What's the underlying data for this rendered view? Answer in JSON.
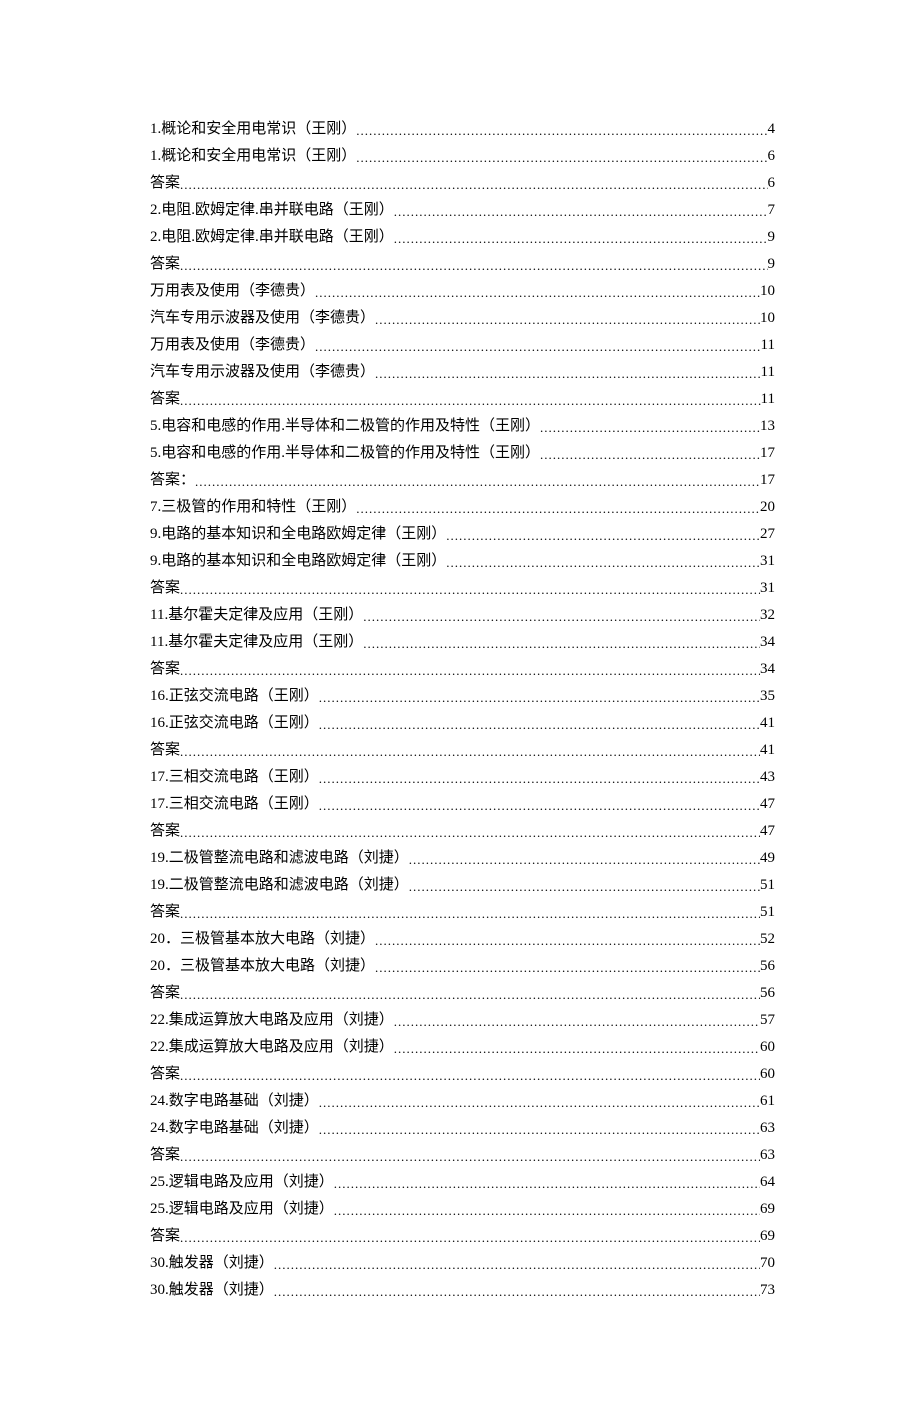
{
  "toc": [
    {
      "title": "1.概论和安全用电常识（王刚）",
      "page": "4"
    },
    {
      "title": "1.概论和安全用电常识（王刚）",
      "page": "6"
    },
    {
      "title": "答案",
      "page": "6"
    },
    {
      "title": "2.电阻.欧姆定律.串并联电路（王刚）",
      "page": "7"
    },
    {
      "title": "2.电阻.欧姆定律.串并联电路（王刚）",
      "page": "9"
    },
    {
      "title": "答案",
      "page": "9"
    },
    {
      "title": "万用表及使用（李德贵）",
      "page": "10"
    },
    {
      "title": "汽车专用示波器及使用（李德贵）",
      "page": "10"
    },
    {
      "title": "万用表及使用（李德贵）",
      "page": "11"
    },
    {
      "title": "汽车专用示波器及使用（李德贵）",
      "page": "11"
    },
    {
      "title": "答案",
      "page": "11"
    },
    {
      "title": "5.电容和电感的作用.半导体和二极管的作用及特性（王刚）",
      "page": "13"
    },
    {
      "title": "5.电容和电感的作用.半导体和二极管的作用及特性（王刚）",
      "page": "17"
    },
    {
      "title": "答案：",
      "page": "17"
    },
    {
      "title": "7.三极管的作用和特性（王刚）",
      "page": "20"
    },
    {
      "title": "9.电路的基本知识和全电路欧姆定律（王刚）",
      "page": "27"
    },
    {
      "title": "9.电路的基本知识和全电路欧姆定律（王刚）",
      "page": "31"
    },
    {
      "title": "答案",
      "page": "31"
    },
    {
      "title": "11.基尔霍夫定律及应用（王刚）",
      "page": "32"
    },
    {
      "title": "11.基尔霍夫定律及应用（王刚）",
      "page": "34"
    },
    {
      "title": "答案",
      "page": "34"
    },
    {
      "title": "16.正弦交流电路（王刚）",
      "page": "35"
    },
    {
      "title": "16.正弦交流电路（王刚）",
      "page": "41"
    },
    {
      "title": "答案",
      "page": "41"
    },
    {
      "title": "17.三相交流电路（王刚）",
      "page": "43"
    },
    {
      "title": "17.三相交流电路（王刚）",
      "page": "47"
    },
    {
      "title": "答案",
      "page": "47"
    },
    {
      "title": "19.二极管整流电路和滤波电路（刘捷）",
      "page": "49"
    },
    {
      "title": "19.二极管整流电路和滤波电路（刘捷）",
      "page": "51"
    },
    {
      "title": "答案",
      "page": "51"
    },
    {
      "title": "20．三极管基本放大电路（刘捷）",
      "page": "52"
    },
    {
      "title": "20．三极管基本放大电路（刘捷）",
      "page": "56"
    },
    {
      "title": "答案",
      "page": "56"
    },
    {
      "title": "22.集成运算放大电路及应用（刘捷）",
      "page": "57"
    },
    {
      "title": "22.集成运算放大电路及应用（刘捷）",
      "page": "60"
    },
    {
      "title": "答案",
      "page": "60"
    },
    {
      "title": "24.数字电路基础（刘捷）",
      "page": "61"
    },
    {
      "title": "24.数字电路基础（刘捷）",
      "page": "63"
    },
    {
      "title": "答案",
      "page": "63"
    },
    {
      "title": "25.逻辑电路及应用（刘捷）",
      "page": "64"
    },
    {
      "title": "25.逻辑电路及应用（刘捷）",
      "page": "69"
    },
    {
      "title": "答案",
      "page": "69"
    },
    {
      "title": "30.触发器（刘捷）",
      "page": "70"
    },
    {
      "title": "30.触发器（刘捷）",
      "page": "73"
    }
  ]
}
